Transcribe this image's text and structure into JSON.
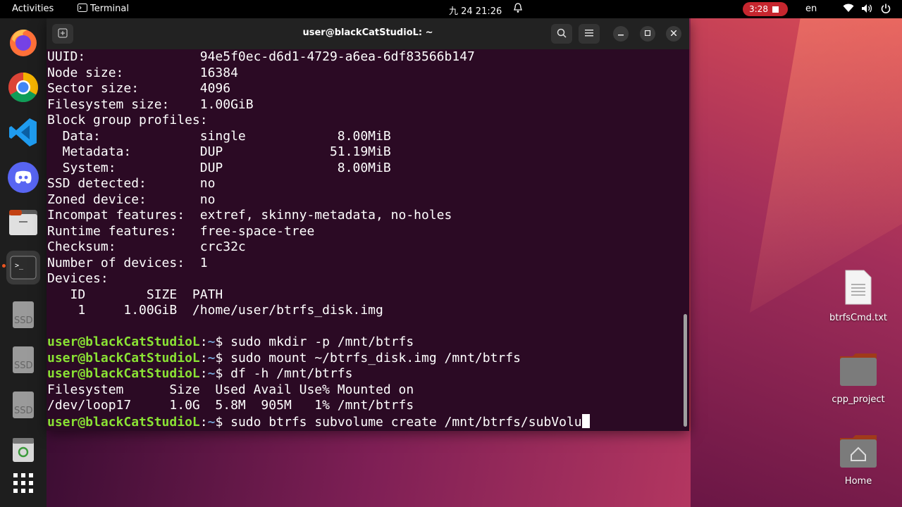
{
  "topbar": {
    "activities": "Activities",
    "app_name": "Terminal",
    "datetime": "九 24 21:26",
    "record_time": "3:28",
    "language": "en"
  },
  "terminal": {
    "title": "user@blackCatStudioL: ~",
    "output_lines": [
      "UUID:               94e5f0ec-d6d1-4729-a6ea-6df83566b147",
      "Node size:          16384",
      "Sector size:        4096",
      "Filesystem size:    1.00GiB",
      "Block group profiles:",
      "  Data:             single            8.00MiB",
      "  Metadata:         DUP              51.19MiB",
      "  System:           DUP               8.00MiB",
      "SSD detected:       no",
      "Zoned device:       no",
      "Incompat features:  extref, skinny-metadata, no-holes",
      "Runtime features:   free-space-tree",
      "Checksum:           crc32c",
      "Number of devices:  1",
      "Devices:",
      "   ID        SIZE  PATH",
      "    1     1.00GiB  /home/user/btrfs_disk.img",
      ""
    ],
    "prompt_user": "user@blackCatStudioL",
    "prompt_sep": ":",
    "prompt_path": "~",
    "prompt_dollar": "$ ",
    "commands": [
      "sudo mkdir -p /mnt/btrfs",
      "sudo mount ~/btrfs_disk.img /mnt/btrfs",
      "df -h /mnt/btrfs"
    ],
    "df_lines": [
      "Filesystem      Size  Used Avail Use% Mounted on",
      "/dev/loop17     1.0G  5.8M  905M   1% /mnt/btrfs"
    ],
    "current_command": "sudo btrfs subvolume create /mnt/btrfs/subVolu"
  },
  "desktop": {
    "icons": [
      "btrfsCmd.txt",
      "cpp_project",
      "Home"
    ]
  },
  "dock": {
    "ssd_label": "SSD"
  }
}
